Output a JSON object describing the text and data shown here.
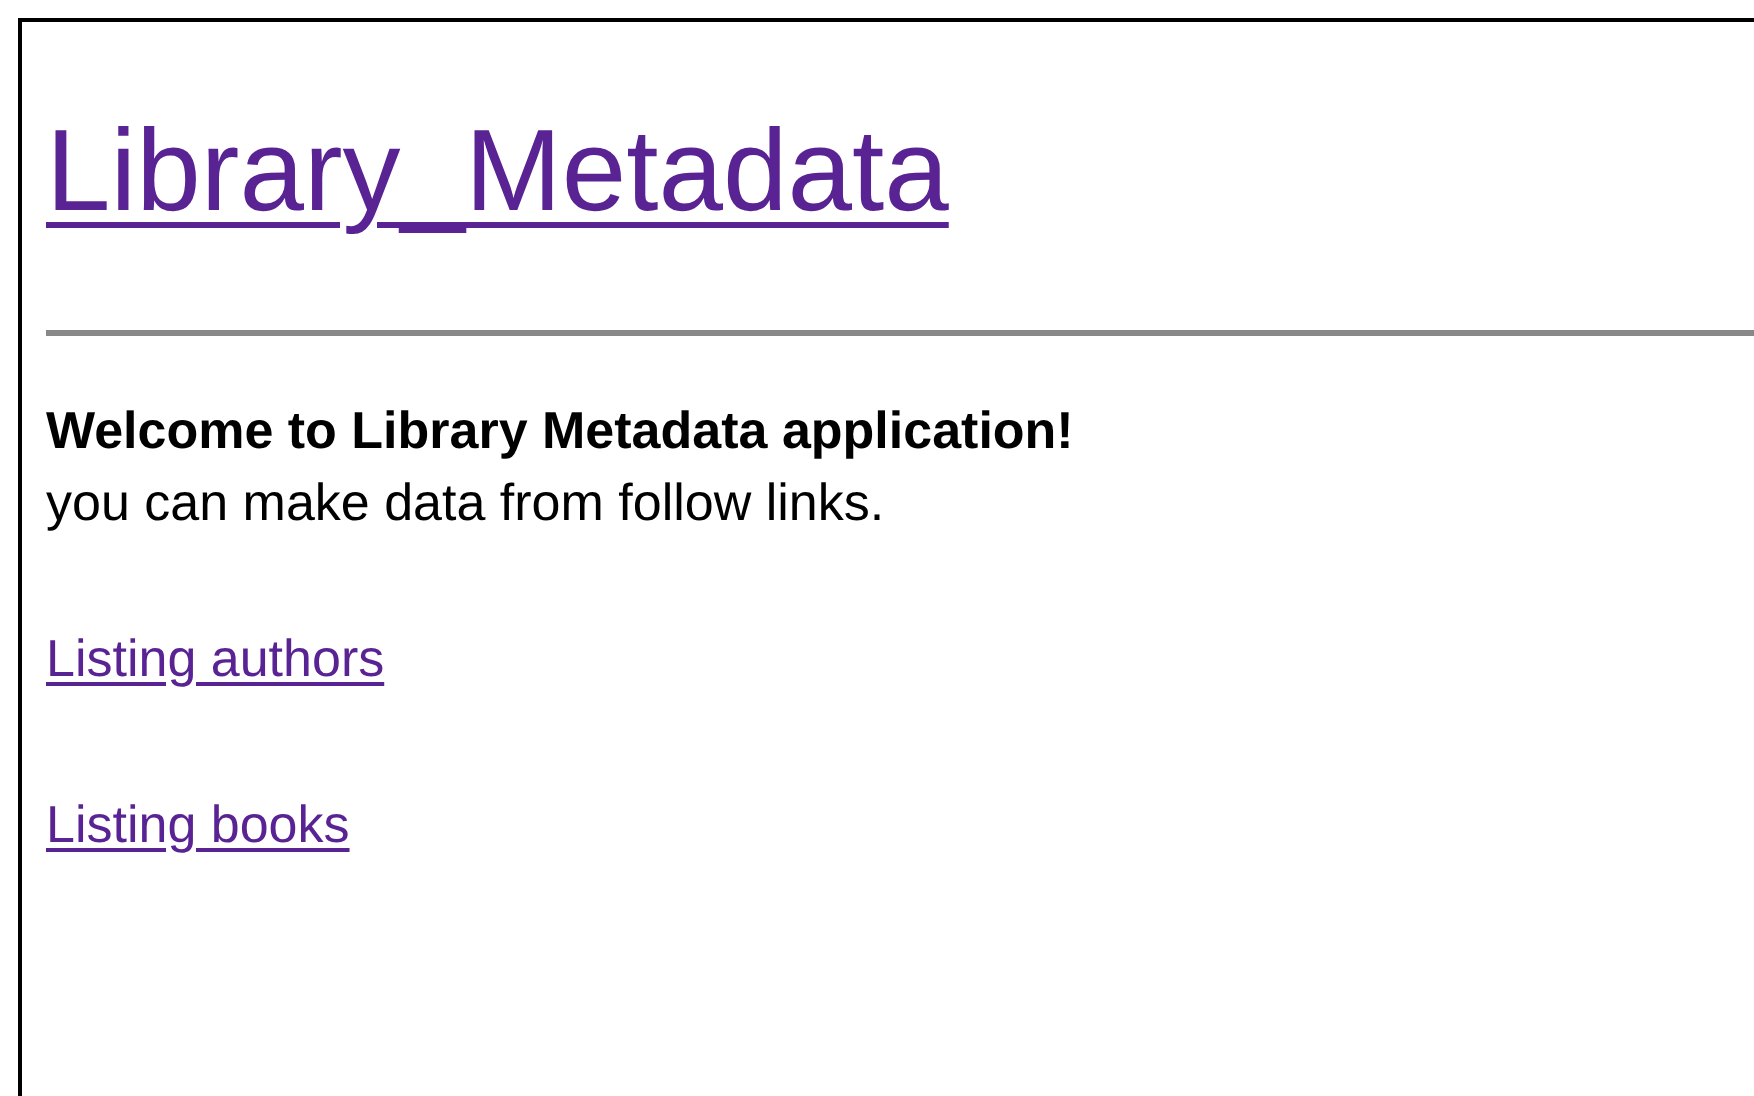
{
  "title": "Library_Metadata",
  "welcome": "Welcome to Library Metadata application!",
  "intro": "you can make data from follow links.",
  "links": [
    {
      "label": "Listing authors"
    },
    {
      "label": "Listing books"
    }
  ]
}
